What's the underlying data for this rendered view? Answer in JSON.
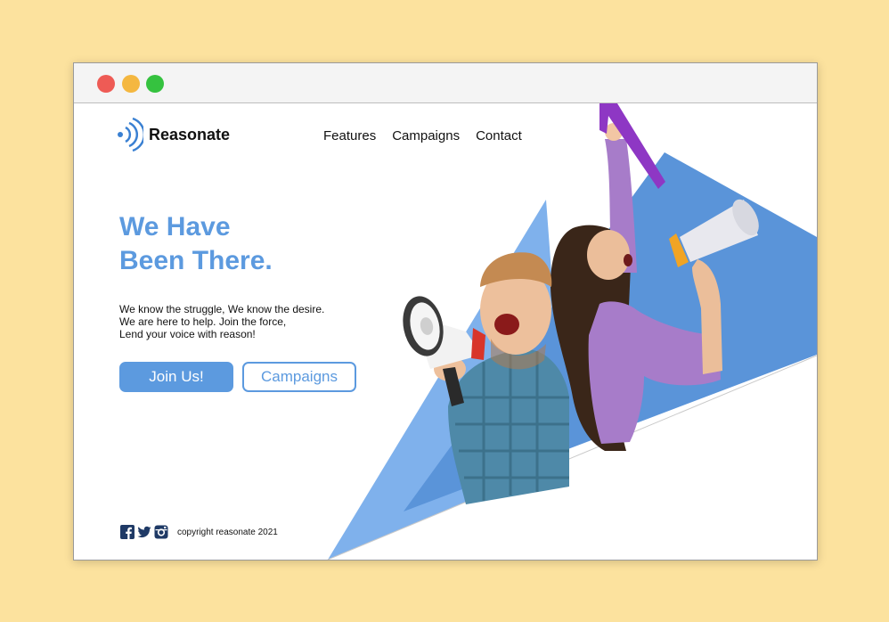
{
  "brand": {
    "name": "Reasonate"
  },
  "nav": {
    "items": [
      "Features",
      "Campaigns",
      "Contact"
    ]
  },
  "hero": {
    "headline": "We  Have\nBeen There.",
    "tagline": [
      "We know the struggle, We know the desire.",
      "We are here to help. Join the force,",
      "Lend your voice with reason!"
    ],
    "primary_button": "Join Us!",
    "secondary_button": "Campaigns"
  },
  "footer": {
    "social_icons": [
      "facebook-icon",
      "twitter-icon",
      "instagram-icon"
    ],
    "copyright": "copyright reasonate 2021"
  },
  "colors": {
    "background": "#FCE29E",
    "accent": "#5C9ADF",
    "window_bar": "#F4F4F4",
    "close_dot": "#EE5B55",
    "minimize_dot": "#F4B740",
    "maximize_dot": "#35C23F"
  }
}
